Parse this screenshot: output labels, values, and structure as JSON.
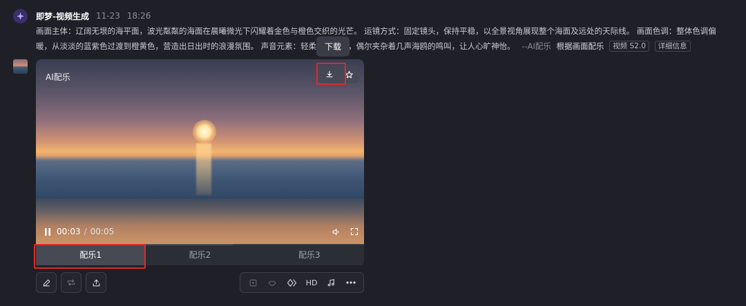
{
  "message": {
    "app_name": "即梦-视频生成",
    "date": "11-23",
    "time": "18:26",
    "prompt_text": "画面主体：辽阔无垠的海平面，波光粼粼的海面在晨曦微光下闪耀着金色与橙色交织的光芒。 运镜方式：固定镜头，保持平稳，以全景视角展现整个海面及远处的天际线。 画面色调：整体色调偏暖，从淡淡的蓝紫色过渡到橙黄色，营造出日出时的浪漫氛围。 声音元素：轻柔的海浪声，偶尔夹杂着几声海鸥的鸣叫，让人心旷神怡。",
    "suffix": "--AI配乐",
    "action_link": "根据画面配乐",
    "tags": [
      "视频 S2.0",
      "详细信息"
    ]
  },
  "tooltip": {
    "text": "下载"
  },
  "video": {
    "label": "AI配乐",
    "time_current": "00:03",
    "time_separator": "/",
    "time_total": "00:05",
    "progress": 0.6
  },
  "music_tabs": [
    {
      "label": "配乐1",
      "active": true
    },
    {
      "label": "配乐2",
      "active": false
    },
    {
      "label": "配乐3",
      "active": false
    }
  ],
  "action_group": {
    "hd_label": "HD"
  },
  "colors": {
    "background": "#1f2027",
    "highlight": "#e02a2a",
    "tab_active": "#474953"
  },
  "icons": {
    "app": "sparkle-icon",
    "download": "download-icon",
    "favorite": "star-icon",
    "pause": "pause-icon",
    "volume": "volume-icon",
    "fullscreen": "fullscreen-icon",
    "edit": "pencil-icon",
    "regenerate": "repeat-icon",
    "share": "upload-icon",
    "more": "more-icon"
  }
}
